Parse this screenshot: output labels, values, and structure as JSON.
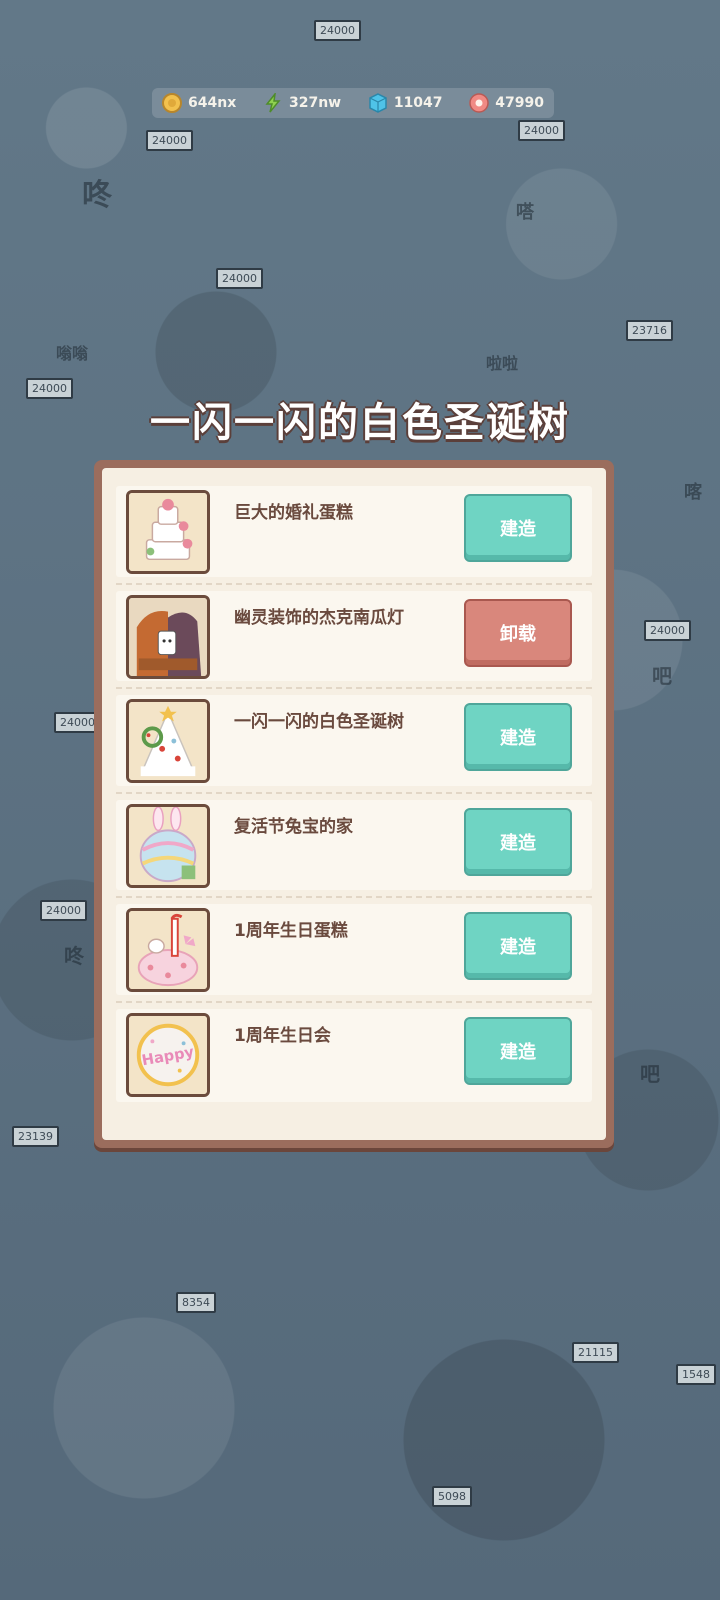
{
  "resources": [
    {
      "icon": "coin-icon",
      "value": "644nx",
      "color": "#f2c14e"
    },
    {
      "icon": "energy-bolt-icon",
      "value": "327nw",
      "color": "#8fd14f"
    },
    {
      "icon": "blue-cube-icon",
      "value": "11047",
      "color": "#4fc3e8"
    },
    {
      "icon": "pink-flower-icon",
      "value": "47990",
      "color": "#f08a84"
    }
  ],
  "title": "一闪一闪的白色圣诞树",
  "items": [
    {
      "name": "巨大的婚礼蛋糕",
      "action": "建造",
      "state": "build",
      "thumb": "wedding-cake-icon"
    },
    {
      "name": "幽灵装饰的杰克南瓜灯",
      "action": "卸载",
      "state": "unload",
      "thumb": "ghost-pumpkin-icon"
    },
    {
      "name": "一闪一闪的白色圣诞树",
      "action": "建造",
      "state": "build",
      "thumb": "christmas-tree-icon"
    },
    {
      "name": "复活节兔宝的家",
      "action": "建造",
      "state": "build",
      "thumb": "easter-bunny-house-icon"
    },
    {
      "name": "1周年生日蛋糕",
      "action": "建造",
      "state": "build",
      "thumb": "anniversary-cake-icon"
    },
    {
      "name": "1周年生日会",
      "action": "建造",
      "state": "build",
      "thumb": "happy-balloon-icon"
    }
  ],
  "background_labels": [
    "咚",
    "嗡嗡",
    "嗒",
    "啦啦",
    "喀",
    "吧",
    "吧",
    "咚"
  ],
  "background_signs": [
    "24000",
    "24000",
    "24000",
    "24000",
    "23716",
    "24000",
    "24000",
    "24000",
    "24000",
    "23139",
    "8354",
    "21115",
    "1548",
    "5098"
  ],
  "balloon_text": "Happy"
}
